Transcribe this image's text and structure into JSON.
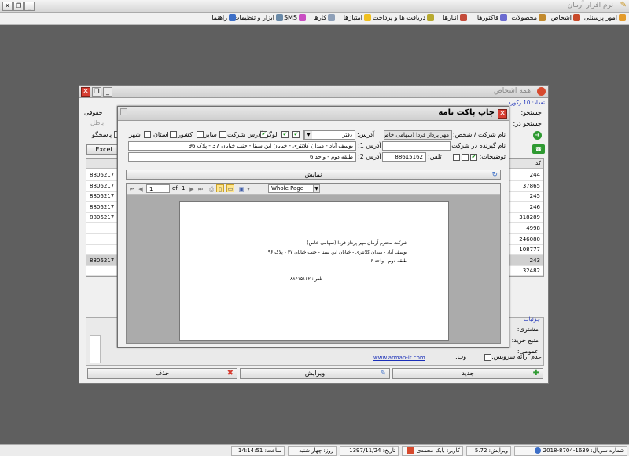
{
  "app": {
    "title": "نرم افزار آرمان"
  },
  "menu": [
    {
      "label": "امور پرسنلی",
      "icon": "personnel-icon"
    },
    {
      "label": "اشخاص",
      "icon": "people-icon"
    },
    {
      "label": "محصولات",
      "icon": "products-icon"
    },
    {
      "label": "فاکتورها",
      "icon": "invoices-icon"
    },
    {
      "label": "انبارها",
      "icon": "warehouse-icon"
    },
    {
      "label": "دریافت ها و پرداخت ها",
      "icon": "payments-icon"
    },
    {
      "label": "امتیازها",
      "icon": "points-icon"
    },
    {
      "label": "کارها",
      "icon": "tasks-icon"
    },
    {
      "label": "SMS",
      "icon": "sms-icon"
    },
    {
      "label": "ابزار و تنظیمات",
      "icon": "tools-icon"
    },
    {
      "label": "راهنما",
      "icon": "help-icon"
    }
  ],
  "people_window": {
    "title": "همه اشخاص",
    "count": "تعداد: 10 رکورد",
    "search_label": "جستجو:",
    "search_in_label": "جستجو در:",
    "legal_label": "حقوقی",
    "inactive_label": "باطل",
    "responder_label": "پاسخگو",
    "excel_label": "Excel",
    "take_label": "گرفتن اط",
    "code_header": "کد",
    "codes": [
      "244",
      "37865",
      "245",
      "246",
      "318289",
      "4998",
      "246080",
      "108777",
      "243",
      "32482"
    ],
    "phones": [
      "8806217",
      "8806217",
      "8806217",
      "8806217",
      "8806217",
      "",
      "",
      "",
      "8806217",
      ""
    ],
    "details_title": "جزئیات",
    "customer_label": "مشتری:",
    "source_label": "منبع خرید:",
    "public_label": "عمومی:",
    "no_service_label": "عدم ارائه سرویس:",
    "web_label": "وب:",
    "website": "www.arman-it.com",
    "new_btn": "جدید",
    "edit_btn": "ویرایش",
    "delete_btn": "حذف"
  },
  "envelope_dialog": {
    "title": "چاپ پاکت نامه",
    "company_label": "نام شرکت / شخص:",
    "company_value": "مهر پرداز فردا (سهامی خاص)",
    "address_label": "آدرس:",
    "address_type": "دفتر",
    "logo_label": "لوگو",
    "company_address_label": "آدرس شرکت",
    "other_label": "سایر",
    "country_label": "کشور",
    "province_label": "استان",
    "city_label": "شهر",
    "recipient_label": "نام گیرنده در شرکت:",
    "address1_label": "آدرس 1:",
    "address1_value": "یوسف آباد - میدان کلانتری - خیابان ابن سینا - جنب خیابان 37 - پلاک 96",
    "notes_label": "توضیحات:",
    "phone_label": "تلفن:",
    "phone_value": "88615162",
    "address2_label": "آدرس 2:",
    "address2_value": "طبقه دوم - واحد 6",
    "show_label": "نمایش",
    "page_current": "1",
    "page_of": "of",
    "page_total": "1",
    "zoom": "Whole Page",
    "preview_lines": [
      "شرکت محترم آرمان مهر پرداز فردا (سهامی خاص)",
      "یوسف آباد - میدان کلانتری - خیابان ابن سینا - جنب خیابان ۳۷ - پلاک ۹۶",
      "طبقه دوم - واحد ۶",
      "تلفن: ۸۸۶۱۵۱۶۲"
    ]
  },
  "status": {
    "serial": "شماره سریال: 1639-8704-2018",
    "version": "ویرایش: 5.72",
    "user": "کاربر: بابک محمدی",
    "date": "تاریخ: 1397/11/24",
    "day": "روز: چهار شنبه",
    "time": "ساعت: 14:14:51"
  },
  "colors": {
    "accent_red": "#d63e32",
    "selected_row": "#d0d0d0",
    "link": "#1a2fb8"
  }
}
